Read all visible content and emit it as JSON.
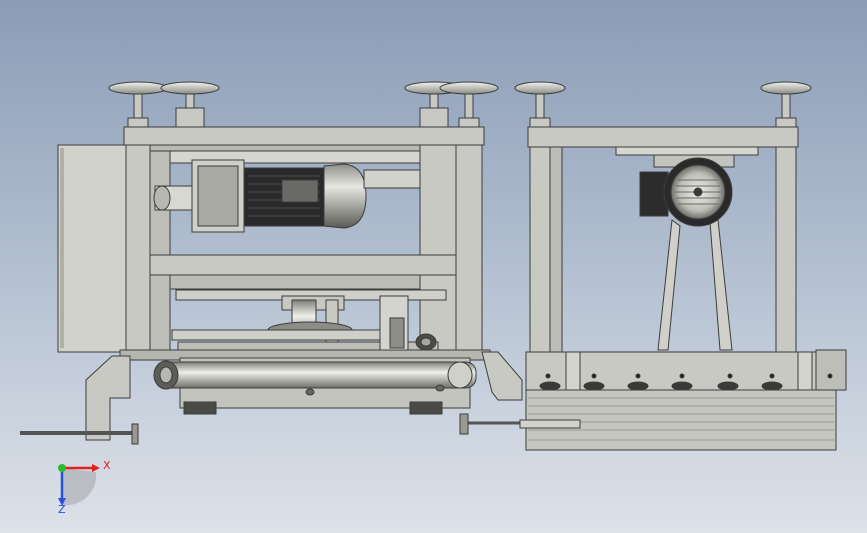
{
  "triad": {
    "x_label": "X",
    "z_label": "Z",
    "colors": {
      "x": "#e0201c",
      "y": "#2dbb2d",
      "z": "#2a4fd8"
    }
  },
  "colors": {
    "background_top": "#8a9cb6",
    "background_bottom": "#dde2e9",
    "frame": "#c9c9c3",
    "frame_edge": "#3c3c3c",
    "motor_body": "#b8b8b0",
    "motor_dark": "#2b2b2b"
  }
}
